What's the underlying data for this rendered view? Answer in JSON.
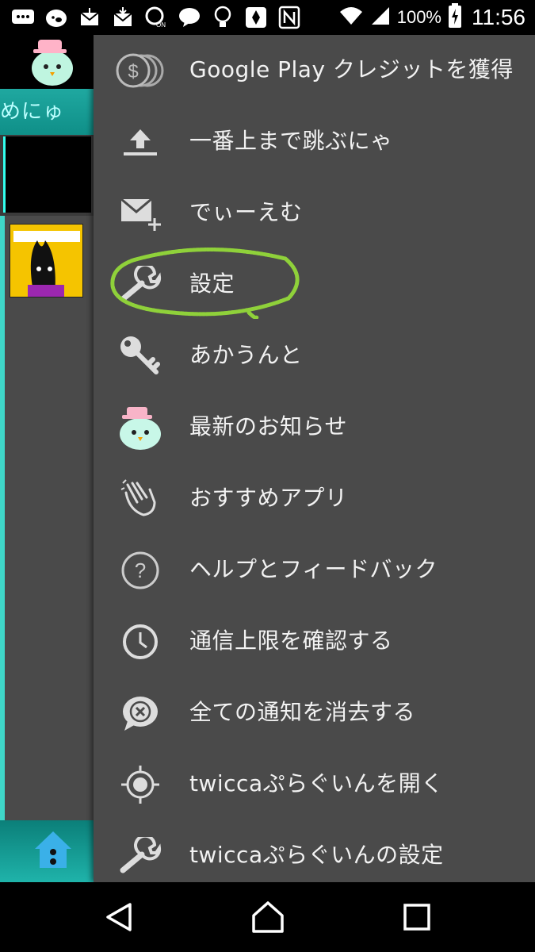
{
  "status_bar": {
    "battery_percent": "100%",
    "time": "11:56"
  },
  "background_app": {
    "tab_label": "めにゅ"
  },
  "menu": {
    "items": [
      {
        "label": "Google Play クレジットを獲得",
        "icon": "coins-icon"
      },
      {
        "label": "一番上まで跳ぶにゃ",
        "icon": "upload-top-icon"
      },
      {
        "label": "でぃーえむ",
        "icon": "mail-add-icon"
      },
      {
        "label": "設定",
        "icon": "wrench-icon"
      },
      {
        "label": "あかうんと",
        "icon": "key-icon"
      },
      {
        "label": "最新のお知らせ",
        "icon": "bird-mascot-icon"
      },
      {
        "label": "おすすめアプリ",
        "icon": "clapping-hands-icon"
      },
      {
        "label": "ヘルプとフィードバック",
        "icon": "help-circle-icon"
      },
      {
        "label": "通信上限を確認する",
        "icon": "clock-icon"
      },
      {
        "label": "全ての通知を消去する",
        "icon": "dismiss-bubble-icon"
      },
      {
        "label": "twiccaぷらぐいんを開く",
        "icon": "target-icon"
      },
      {
        "label": "twiccaぷらぐいんの設定",
        "icon": "wrench-icon"
      }
    ],
    "highlighted_item": "設定",
    "highlight_color": "#8fd13a"
  },
  "nav_bar": {
    "back": "back-icon",
    "home": "home-icon",
    "recents": "recents-icon"
  }
}
